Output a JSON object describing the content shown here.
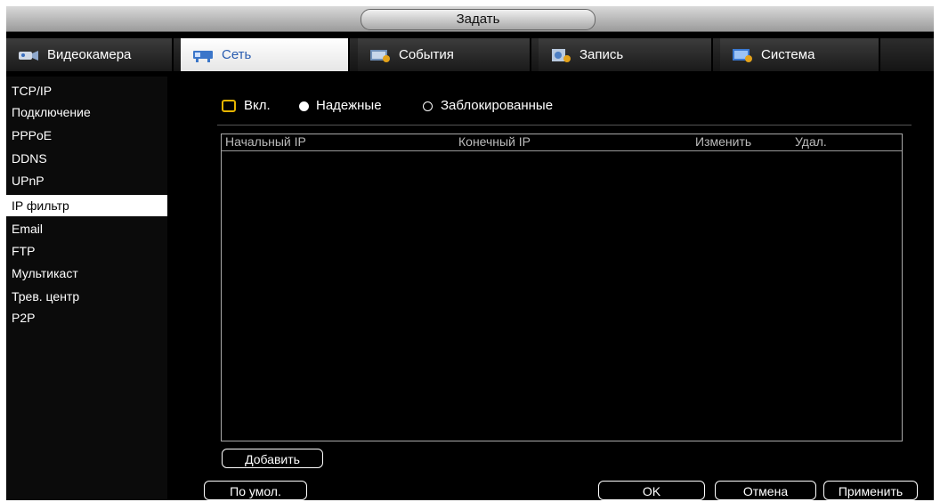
{
  "window": {
    "title": "Задать"
  },
  "tabs": [
    {
      "label": "Видеокамера",
      "icon": "camera-icon"
    },
    {
      "label": "Сеть",
      "icon": "network-icon"
    },
    {
      "label": "События",
      "icon": "events-icon"
    },
    {
      "label": "Запись",
      "icon": "record-icon"
    },
    {
      "label": "Система",
      "icon": "system-icon"
    }
  ],
  "sidebar": {
    "items": [
      {
        "label": "TCP/IP"
      },
      {
        "label": "Подключение"
      },
      {
        "label": "PPPoE"
      },
      {
        "label": "DDNS"
      },
      {
        "label": "UPnP"
      },
      {
        "label": "IP фильтр"
      },
      {
        "label": "Email"
      },
      {
        "label": "FTP"
      },
      {
        "label": "Мультикаст"
      },
      {
        "label": "Трев. центр"
      },
      {
        "label": "P2P"
      }
    ],
    "active_index": 5
  },
  "filter": {
    "enable_label": "Вкл.",
    "trusted_label": "Надежные",
    "blocked_label": "Заблокированные",
    "mode_selected": "Надежные"
  },
  "table": {
    "columns": [
      "Начальный IP",
      "Конечный IP",
      "Изменить",
      "Удал."
    ],
    "rows": []
  },
  "buttons": {
    "add": "Добавить",
    "default": "По умол.",
    "ok": "OK",
    "cancel": "Отмена",
    "apply": "Применить"
  },
  "colors": {
    "accent": "#2a5db0",
    "checkbox": "#e6b400"
  }
}
